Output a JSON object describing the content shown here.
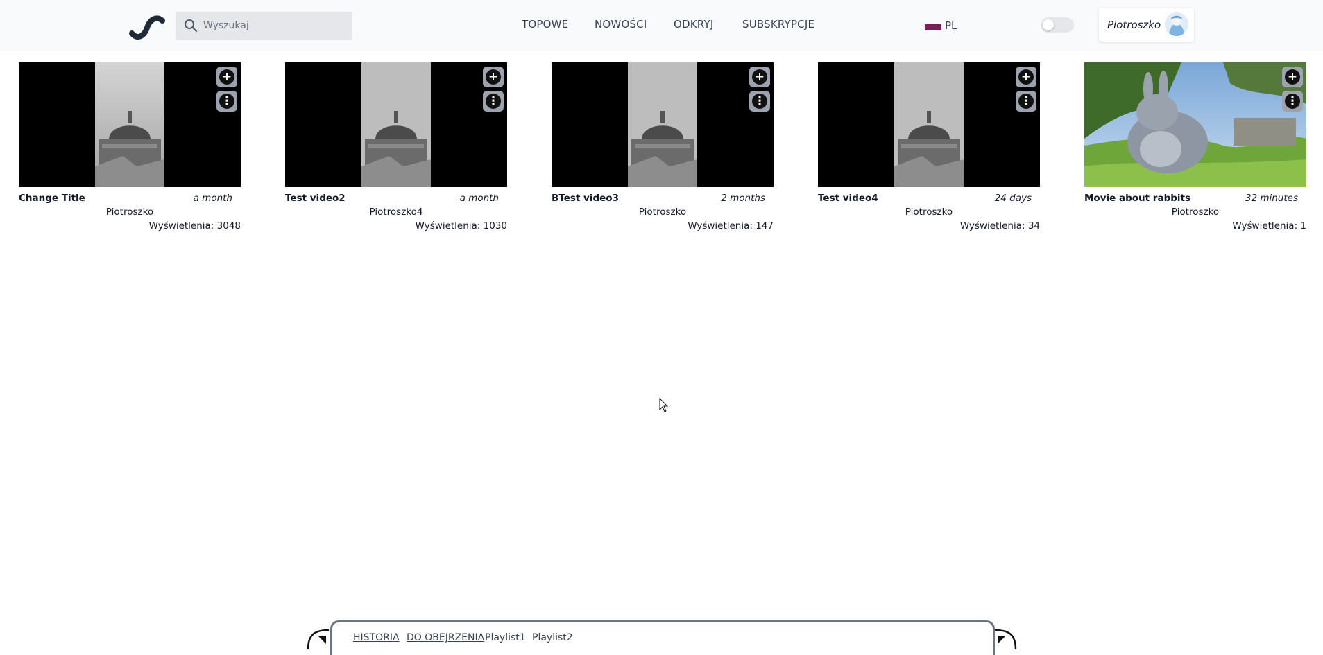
{
  "header": {
    "search_placeholder": "Wyszukaj",
    "nav": [
      "TOPOWE",
      "NOWOŚCI",
      "ODKRYJ",
      "SUBSKRYPCJE"
    ],
    "language": "PL",
    "flag_color": "#7b1e5b",
    "theme_toggle_on": false,
    "user_name": "Piotroszko"
  },
  "videos": [
    {
      "title": "Change Title",
      "age": "a month",
      "author": "Piotroszko",
      "views": "Wyświetlenia: 3048",
      "thumbnail": "dome"
    },
    {
      "title": "Test video2",
      "age": "a month",
      "author": "Piotroszko4",
      "views": "Wyświetlenia: 1030",
      "thumbnail": "dome"
    },
    {
      "title": "BTest video3",
      "age": "2 months",
      "author": "Piotroszko",
      "views": "Wyświetlenia: 147",
      "thumbnail": "dome"
    },
    {
      "title": "Test video4",
      "age": "24 days",
      "author": "Piotroszko",
      "views": "Wyświetlenia: 34",
      "thumbnail": "dome"
    },
    {
      "title": "Movie about rabbits",
      "age": "32 minutes",
      "author": "Piotroszko",
      "views": "Wyświetlenia: 1",
      "thumbnail": "rabbit"
    }
  ],
  "icons": {
    "add": "plus-circle-icon",
    "more": "vertical-dots-icon",
    "search": "search-icon",
    "logo": "s-logo-icon"
  },
  "bottom_bar": {
    "tabs": [
      "HISTORIA",
      "DO OBEJRZENIA",
      "Playlist1",
      "Playlist2"
    ]
  }
}
